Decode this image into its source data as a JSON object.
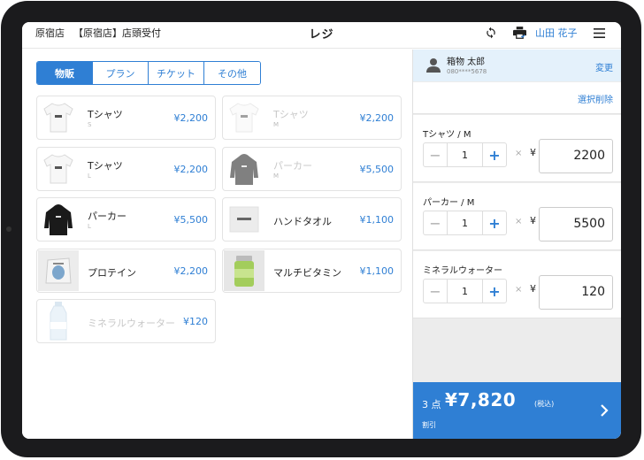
{
  "header": {
    "store_name": "原宿店",
    "register_name": "【原宿店】店頭受付",
    "title": "レジ",
    "user_name": "山田 花子",
    "icons": [
      "sync-icon",
      "print-icon",
      "menu-icon"
    ]
  },
  "tabs": [
    {
      "label": "物販",
      "active": true
    },
    {
      "label": "プラン",
      "active": false
    },
    {
      "label": "チケット",
      "active": false
    },
    {
      "label": "その他",
      "active": false
    }
  ],
  "products": [
    {
      "name": "Tシャツ",
      "variant": "S",
      "price": "¥2,200",
      "thumb": "tshirt-icon",
      "disabled": false
    },
    {
      "name": "Tシャツ",
      "variant": "M",
      "price": "¥2,200",
      "thumb": "tshirt-icon",
      "disabled": true
    },
    {
      "name": "Tシャツ",
      "variant": "L",
      "price": "¥2,200",
      "thumb": "tshirt-icon",
      "disabled": false
    },
    {
      "name": "パーカー",
      "variant": "M",
      "price": "¥5,500",
      "thumb": "hoodie-icon",
      "disabled": true
    },
    {
      "name": "パーカー",
      "variant": "L",
      "price": "¥5,500",
      "thumb": "hoodie-icon",
      "disabled": false
    },
    {
      "name": "ハンドタオル",
      "variant": "",
      "price": "¥1,100",
      "thumb": "towel-icon",
      "disabled": false
    },
    {
      "name": "プロテイン",
      "variant": "",
      "price": "¥2,200",
      "thumb": "protein-icon",
      "disabled": false
    },
    {
      "name": "マルチビタミン",
      "variant": "",
      "price": "¥1,100",
      "thumb": "vitamin-icon",
      "disabled": false
    },
    {
      "name": "ミネラルウォーター",
      "variant": "",
      "price": "¥120",
      "thumb": "water-bottle-icon",
      "disabled": true
    }
  ],
  "customer": {
    "name": "箱物 太郎",
    "phone": "080****5678",
    "change_label": "変更"
  },
  "cart": {
    "select_delete_label": "選択削除",
    "times_symbol": "×",
    "yen_symbol": "¥",
    "lines": [
      {
        "name": "Tシャツ / M",
        "qty": "1",
        "price": "2200"
      },
      {
        "name": "パーカー / M",
        "qty": "1",
        "price": "5500"
      },
      {
        "name": "ミネラルウォーター",
        "qty": "1",
        "price": "120"
      }
    ]
  },
  "total": {
    "count": "3 点",
    "amount": "¥7,820",
    "tax_label": "(税込)",
    "discount_label": "割引"
  },
  "colors": {
    "accent": "#2f7fd4",
    "customer_bg": "#e4f1fb",
    "frame": "#1b1b1d"
  }
}
